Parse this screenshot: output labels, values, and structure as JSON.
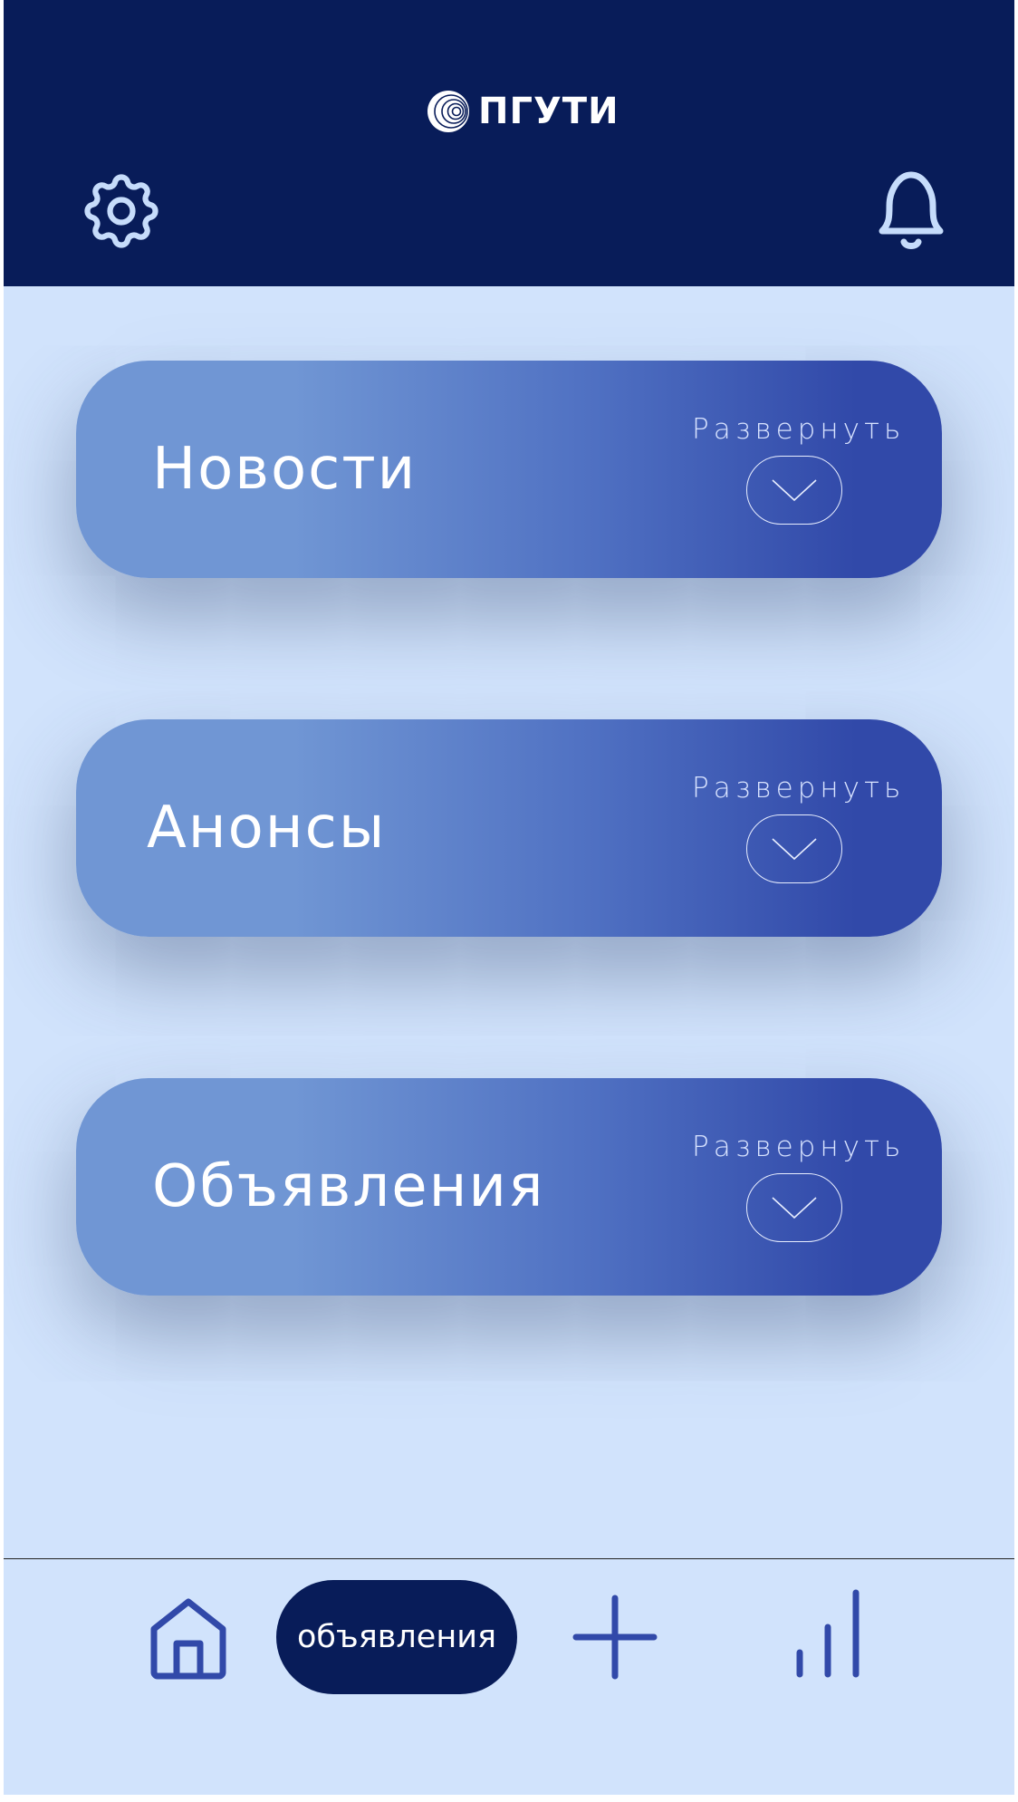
{
  "header": {
    "logo_text": "ПГУТИ",
    "icons": {
      "settings": "gear-icon",
      "notifications": "bell-icon"
    }
  },
  "cards": [
    {
      "title": "Новости",
      "expand_label": "Развернуть"
    },
    {
      "title": "Анонсы",
      "expand_label": "Развернуть"
    },
    {
      "title": "Объявления",
      "expand_label": "Развернуть"
    }
  ],
  "bottom_nav": {
    "active_label": "объявления",
    "icons": {
      "home": "home-icon",
      "add": "plus-icon",
      "stats": "stats-icon"
    }
  },
  "colors": {
    "header_bg": "#081c59",
    "screen_bg": "#d1e3fc",
    "card_gradient_start": "#7096d4",
    "card_gradient_end": "#3149a9",
    "accent": "#3149a9",
    "icon_light": "#c6dcfb"
  }
}
